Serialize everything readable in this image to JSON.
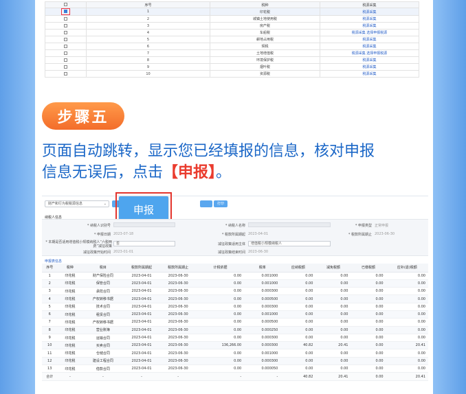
{
  "top_table": {
    "headers": [
      "选择",
      "序号",
      "税种",
      "税源采集"
    ],
    "rows": [
      {
        "no": "1",
        "tax": "印花税",
        "action": "税源采集",
        "checked": true
      },
      {
        "no": "2",
        "tax": "城镇土地使用税",
        "action": "税源采集",
        "checked": false
      },
      {
        "no": "3",
        "tax": "房产税",
        "action": "税源采集",
        "checked": false
      },
      {
        "no": "4",
        "tax": "车船税",
        "action": "税源采集 选择申报税源",
        "checked": false
      },
      {
        "no": "5",
        "tax": "耕地占用税",
        "action": "税源采集",
        "checked": false
      },
      {
        "no": "6",
        "tax": "契税",
        "action": "税源采集",
        "checked": false
      },
      {
        "no": "7",
        "tax": "土地增值税",
        "action": "税源采集 选择申报税源",
        "checked": false
      },
      {
        "no": "8",
        "tax": "环境保护税",
        "action": "税源采集",
        "checked": false
      },
      {
        "no": "9",
        "tax": "烟叶税",
        "action": "税源采集",
        "checked": false
      },
      {
        "no": "10",
        "tax": "资源税",
        "action": "税源采集",
        "checked": false
      }
    ]
  },
  "step": {
    "badge": "步骤五",
    "line1": "页面自动跳转，显示您已经填报的信息，核对申报",
    "line2_prefix": "信息无误后，点击",
    "line2_emph": "【申报】",
    "line2_suffix": "。"
  },
  "form": {
    "top_select": "财产和行为税税源信息",
    "submit_label": "申报",
    "print_label": "打印",
    "section_title": "纳税人信息",
    "labels": {
      "taxpayer_id": "* 纳税人识别号",
      "taxpayer_name": "* 纳税人名称",
      "declare_type": "* 申报类型",
      "declare_date": "* 申报日期",
      "period_start": "* 税款所属期起",
      "period_end": "* 税款所属期止",
      "six_tax": "* 本期是否适用增值税小规模纳税人“六税两费”减征政策",
      "six_tax_value": "否",
      "reduce_subject": "减征政策适用主体",
      "reduce_subject_value": "增值税小规模纳税人",
      "reduce_start": "减征政策开始时间",
      "reduce_end": "减征政策结束时间"
    },
    "values": {
      "declare_type": "正常申报",
      "declare_date": "2023-07-18",
      "period_start": "2023-04-01",
      "period_end": "2023-06-30",
      "reduce_start": "2023-01-01",
      "reduce_end": "2023-06-30"
    },
    "detail_title": "申报表信息",
    "detail_headers": [
      "序号",
      "税种",
      "税目",
      "税款所属期起",
      "税款所属期止",
      "计税依据",
      "税率",
      "应纳税额",
      "减免税额",
      "已缴税额",
      "应补(退)税额"
    ],
    "detail_rows": [
      [
        "1",
        "印花税",
        "财产保险合同",
        "2023-04-01",
        "2023-06-30",
        "0.00",
        "0.001000",
        "0.00",
        "0.00",
        "0.00",
        "0.00"
      ],
      [
        "2",
        "印花税",
        "保管合同",
        "2023-04-01",
        "2023-06-30",
        "0.00",
        "0.001000",
        "0.00",
        "0.00",
        "0.00",
        "0.00"
      ],
      [
        "3",
        "印花税",
        "承揽合同",
        "2023-04-01",
        "2023-06-30",
        "0.00",
        "0.000300",
        "0.00",
        "0.00",
        "0.00",
        "0.00"
      ],
      [
        "4",
        "印花税",
        "产权转移书据",
        "2023-04-01",
        "2023-06-30",
        "0.00",
        "0.000500",
        "0.00",
        "0.00",
        "0.00",
        "0.00"
      ],
      [
        "5",
        "印花税",
        "技术合同",
        "2023-04-01",
        "2023-06-30",
        "0.00",
        "0.000300",
        "0.00",
        "0.00",
        "0.00",
        "0.00"
      ],
      [
        "6",
        "印花税",
        "租赁合同",
        "2023-04-01",
        "2023-06-30",
        "0.00",
        "0.001000",
        "0.00",
        "0.00",
        "0.00",
        "0.00"
      ],
      [
        "7",
        "印花税",
        "产权转移书据",
        "2023-04-01",
        "2023-06-30",
        "0.00",
        "0.000500",
        "0.00",
        "0.00",
        "0.00",
        "0.00"
      ],
      [
        "8",
        "印花税",
        "营业账簿",
        "2023-04-01",
        "2023-06-30",
        "0.00",
        "0.000250",
        "0.00",
        "0.00",
        "0.00",
        "0.00"
      ],
      [
        "9",
        "印花税",
        "运输合同",
        "2023-04-01",
        "2023-06-30",
        "0.00",
        "0.000300",
        "0.00",
        "0.00",
        "0.00",
        "0.00"
      ],
      [
        "10",
        "印花税",
        "买卖合同",
        "2023-04-01",
        "2023-06-30",
        "136,266.00",
        "0.000300",
        "40.82",
        "20.41",
        "0.00",
        "20.41"
      ],
      [
        "11",
        "印花税",
        "仓储合同",
        "2023-04-01",
        "2023-06-30",
        "0.00",
        "0.001000",
        "0.00",
        "0.00",
        "0.00",
        "0.00"
      ],
      [
        "12",
        "印花税",
        "建设工程合同",
        "2023-04-01",
        "2023-06-30",
        "0.00",
        "0.000300",
        "0.00",
        "0.00",
        "0.00",
        "0.00"
      ],
      [
        "13",
        "印花税",
        "借款合同",
        "2023-04-01",
        "2023-06-30",
        "0.00",
        "0.000050",
        "0.00",
        "0.00",
        "0.00",
        "0.00"
      ]
    ],
    "total_row": [
      "合计",
      "-",
      "-",
      "-",
      "-",
      "-",
      "-",
      "40.82",
      "20.41",
      "0.00",
      "20.41"
    ]
  },
  "colors": {
    "accent": "#1b67c7",
    "highlight": "#ea3c2e",
    "badge": "#f36d2a",
    "button": "#4ea5ee"
  }
}
